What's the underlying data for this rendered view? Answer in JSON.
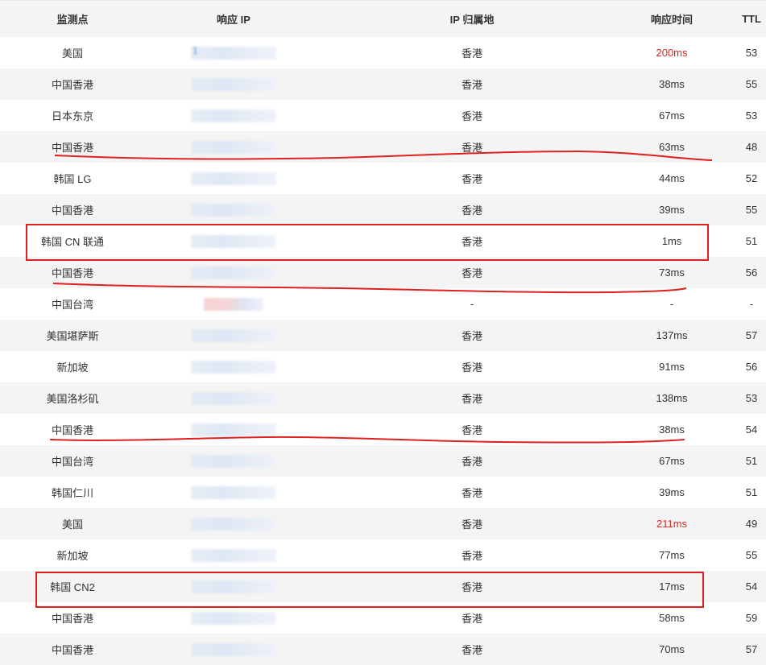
{
  "columns": {
    "location": "监测点",
    "ip": "响应 IP",
    "geo": "IP 归属地",
    "time": "响应时间",
    "ttl": "TTL"
  },
  "rows": [
    {
      "location": "美国",
      "ip_fragment": "1",
      "geo": "香港",
      "time": "200ms",
      "ttl": "53",
      "slow": true
    },
    {
      "location": "中国香港",
      "ip_fragment": "",
      "geo": "香港",
      "time": "38ms",
      "ttl": "55",
      "slow": false
    },
    {
      "location": "日本东京",
      "ip_fragment": "",
      "geo": "香港",
      "time": "67ms",
      "ttl": "53",
      "slow": false
    },
    {
      "location": "中国香港",
      "ip_fragment": "",
      "geo": "香港",
      "time": "63ms",
      "ttl": "48",
      "slow": false
    },
    {
      "location": "韩国 LG",
      "ip_fragment": "",
      "geo": "香港",
      "time": "44ms",
      "ttl": "52",
      "slow": false
    },
    {
      "location": "中国香港",
      "ip_fragment": "",
      "geo": "香港",
      "time": "39ms",
      "ttl": "55",
      "slow": false
    },
    {
      "location": "韩国 CN 联通",
      "ip_fragment": "",
      "geo": "香港",
      "time": "1ms",
      "ttl": "51",
      "slow": false
    },
    {
      "location": "中国香港",
      "ip_fragment": "",
      "geo": "香港",
      "time": "73ms",
      "ttl": "56",
      "slow": false
    },
    {
      "location": "中国台湾",
      "ip_fragment": "",
      "geo": "-",
      "time": "-",
      "ttl": "-",
      "slow": false,
      "pink": true
    },
    {
      "location": "美国堪萨斯",
      "ip_fragment": "",
      "geo": "香港",
      "time": "137ms",
      "ttl": "57",
      "slow": false
    },
    {
      "location": "新加坡",
      "ip_fragment": "",
      "geo": "香港",
      "time": "91ms",
      "ttl": "56",
      "slow": false
    },
    {
      "location": "美国洛杉矶",
      "ip_fragment": "",
      "geo": "香港",
      "time": "138ms",
      "ttl": "53",
      "slow": false
    },
    {
      "location": "中国香港",
      "ip_fragment": "",
      "geo": "香港",
      "time": "38ms",
      "ttl": "54",
      "slow": false
    },
    {
      "location": "中国台湾",
      "ip_fragment": "",
      "geo": "香港",
      "time": "67ms",
      "ttl": "51",
      "slow": false
    },
    {
      "location": "韩国仁川",
      "ip_fragment": "",
      "geo": "香港",
      "time": "39ms",
      "ttl": "51",
      "slow": false
    },
    {
      "location": "美国",
      "ip_fragment": "",
      "geo": "香港",
      "time": "211ms",
      "ttl": "49",
      "slow": true
    },
    {
      "location": "新加坡",
      "ip_fragment": "",
      "geo": "香港",
      "time": "77ms",
      "ttl": "55",
      "slow": false
    },
    {
      "location": "韩国 CN2",
      "ip_fragment": "",
      "geo": "香港",
      "time": "17ms",
      "ttl": "54",
      "slow": false
    },
    {
      "location": "中国香港",
      "ip_fragment": "",
      "geo": "香港",
      "time": "58ms",
      "ttl": "59",
      "slow": false
    },
    {
      "location": "中国香港",
      "ip_fragment": "",
      "geo": "香港",
      "time": "70ms",
      "ttl": "57",
      "slow": false
    }
  ],
  "colors": {
    "slow_time": "#dd2222",
    "annotation": "#e02020",
    "row_alt": "#f4f4f4",
    "header_bg": "#f5f5f5"
  },
  "annotations": {
    "boxed_rows": [
      6,
      17
    ],
    "underlined_rows": [
      3,
      7,
      12
    ]
  }
}
